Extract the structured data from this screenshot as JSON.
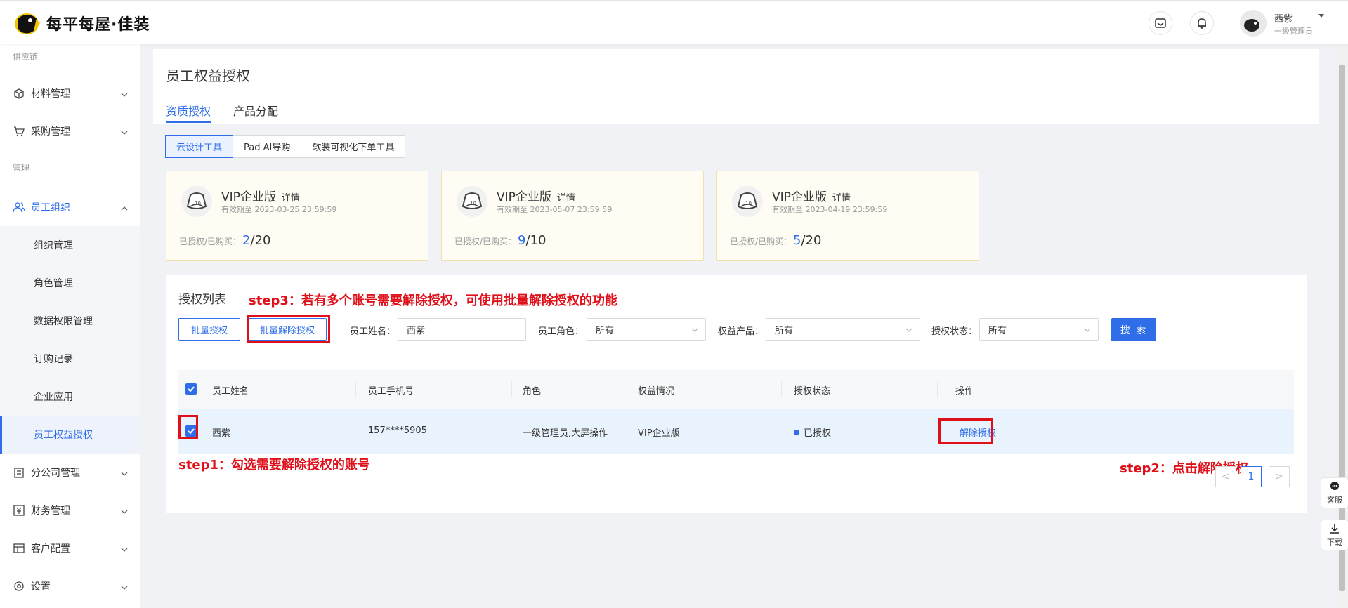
{
  "brand": {
    "name": "每平每屋·佳装"
  },
  "header": {
    "user_name": "西紫",
    "user_role": "一级管理员"
  },
  "sidebar": {
    "group_supply": "供应链",
    "group_manage": "管理",
    "items": [
      {
        "label": "材料管理"
      },
      {
        "label": "采购管理"
      },
      {
        "label": "员工组织"
      },
      {
        "label": "分公司管理"
      },
      {
        "label": "财务管理"
      },
      {
        "label": "客户配置"
      },
      {
        "label": "设置"
      }
    ],
    "subitems": [
      {
        "label": "组织管理"
      },
      {
        "label": "角色管理"
      },
      {
        "label": "数据权限管理"
      },
      {
        "label": "订购记录"
      },
      {
        "label": "企业应用"
      },
      {
        "label": "员工权益授权"
      }
    ]
  },
  "main": {
    "title": "员工权益授权",
    "tabs": [
      {
        "label": "资质授权"
      },
      {
        "label": "产品分配"
      }
    ],
    "segments": [
      {
        "label": "云设计工具"
      },
      {
        "label": "Pad AI导购"
      },
      {
        "label": "软装可视化下单工具"
      }
    ],
    "cards": [
      {
        "title": "VIP企业版",
        "detail": "详情",
        "expiry": "有效期至 2023-03-25 23:59:59",
        "count_label": "已授权/已购买：",
        "authorized": "2",
        "total": "/20"
      },
      {
        "title": "VIP企业版",
        "detail": "详情",
        "expiry": "有效期至 2023-05-07 23:59:59",
        "count_label": "已授权/已购买：",
        "authorized": "9",
        "total": "/10"
      },
      {
        "title": "VIP企业版",
        "detail": "详情",
        "expiry": "有效期至 2023-04-19 23:59:59",
        "count_label": "已授权/已购买：",
        "authorized": "5",
        "total": "/20"
      }
    ],
    "list": {
      "title": "授权列表",
      "batch_grant": "批量授权",
      "batch_revoke": "批量解除授权",
      "filters": {
        "name_label": "员工姓名：",
        "name_value": "西紫",
        "role_label": "员工角色：",
        "role_value": "所有",
        "product_label": "权益产品：",
        "product_value": "所有",
        "status_label": "授权状态：",
        "status_value": "所有"
      },
      "search": "搜 索",
      "columns": [
        "员工姓名",
        "员工手机号",
        "角色",
        "权益情况",
        "授权状态",
        "操作"
      ],
      "rows": [
        {
          "name": "西紫",
          "phone": "157****5905",
          "role": "一级管理员,大屏操作",
          "benefit": "VIP企业版",
          "status": "已授权",
          "action": "解除授权"
        }
      ],
      "pagination": {
        "prev": "<",
        "current": "1",
        "next": ">"
      }
    }
  },
  "annotations": {
    "step1": "step1：勾选需要解除授权的账号",
    "step2": "step2：点击解除授权",
    "step3": "step3：若有多个账号需要解除授权，可使用批量解除授权的功能"
  },
  "float": {
    "service": "客服",
    "download": "下载"
  },
  "colors": {
    "accent": "#2f6ee8",
    "annotation": "#e0101a",
    "card_bg": "#fffcf4",
    "card_border": "#f3dfa9"
  }
}
